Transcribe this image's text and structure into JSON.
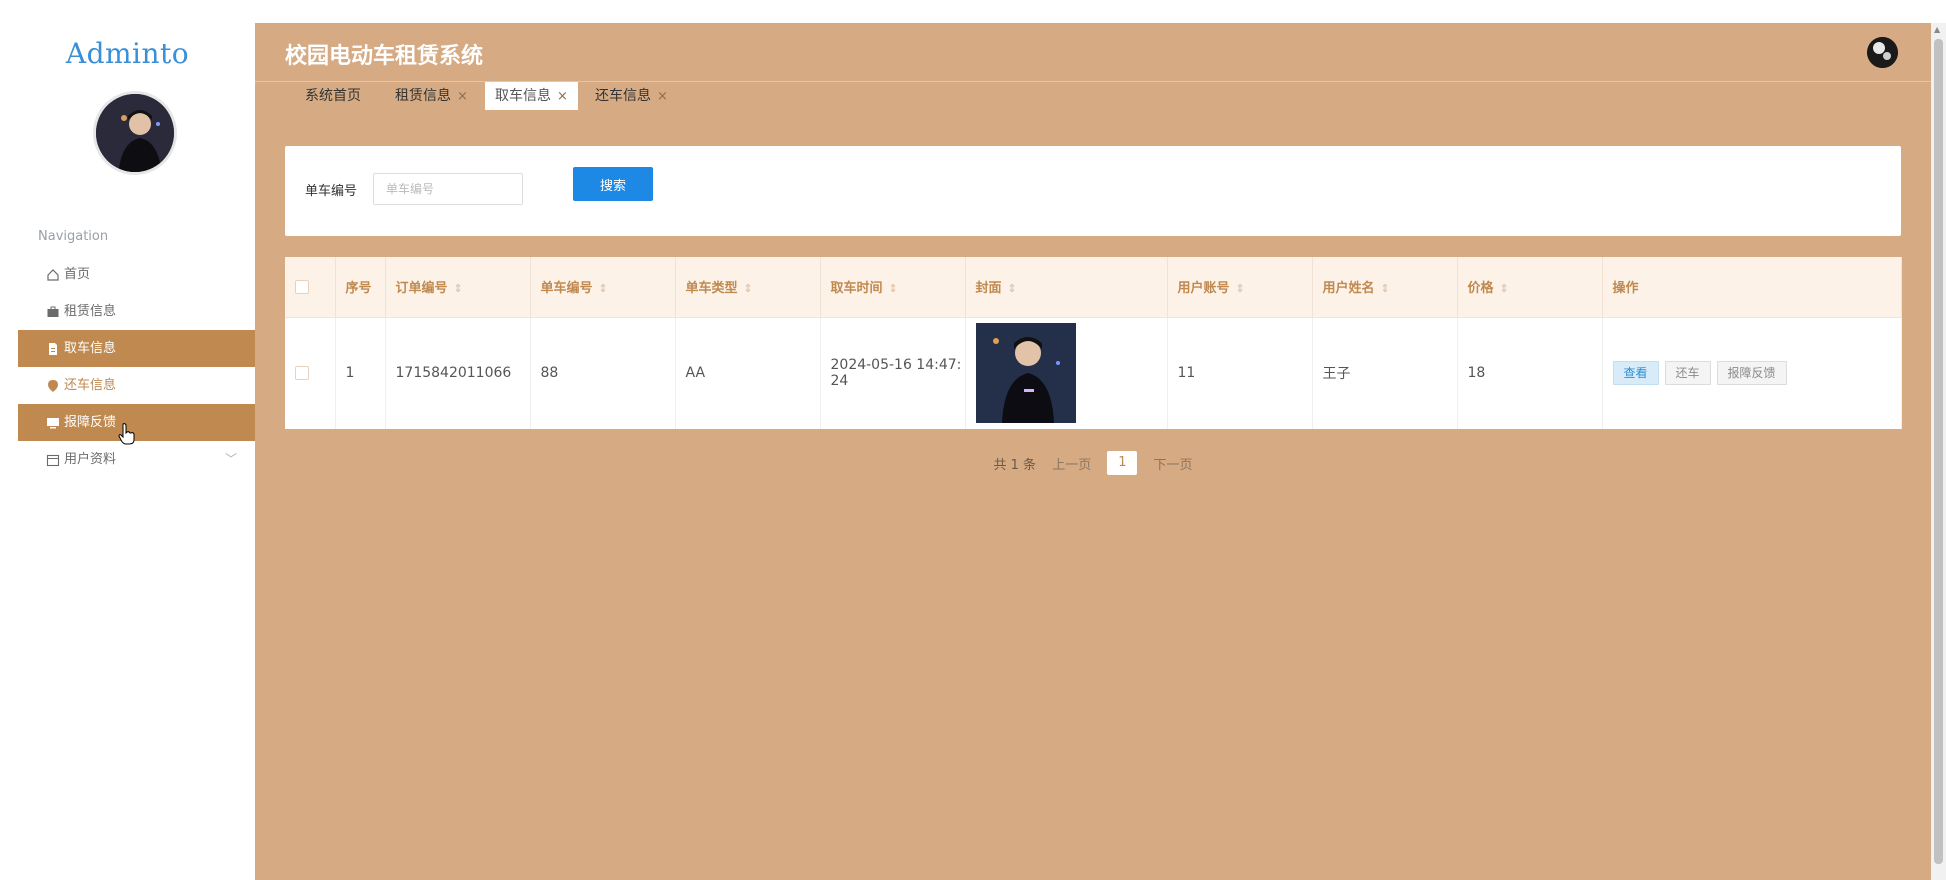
{
  "sidebar": {
    "logo": "Adminto",
    "nav_title": "Navigation",
    "items": [
      {
        "label": "首页",
        "icon": "home-icon"
      },
      {
        "label": "租赁信息",
        "icon": "briefcase-icon"
      },
      {
        "label": "取车信息",
        "icon": "document-icon"
      },
      {
        "label": "还车信息",
        "icon": "location-pin-icon"
      },
      {
        "label": "报障反馈",
        "icon": "monitor-icon"
      },
      {
        "label": "用户资料",
        "icon": "calendar-icon"
      }
    ]
  },
  "header": {
    "title": "校园电动车租赁系统"
  },
  "tabs": [
    {
      "label": "系统首页",
      "closable": false
    },
    {
      "label": "租赁信息",
      "closable": true
    },
    {
      "label": "取车信息",
      "closable": true,
      "active": true
    },
    {
      "label": "还车信息",
      "closable": true
    }
  ],
  "search": {
    "label": "单车编号",
    "placeholder": "单车编号",
    "button": "搜索"
  },
  "table": {
    "columns": [
      "序号",
      "订单编号",
      "单车编号",
      "单车类型",
      "取车时间",
      "封面",
      "用户账号",
      "用户姓名",
      "价格",
      "操作"
    ],
    "rows": [
      {
        "index": "1",
        "order_no": "1715842011066",
        "bike_no": "88",
        "bike_type": "AA",
        "pickup_time_line1": "2024-05-16 14:47:",
        "pickup_time_line2": "24",
        "user_account": "11",
        "user_name": "王子",
        "price": "18",
        "actions": [
          "查看",
          "还车",
          "报障反馈"
        ]
      }
    ]
  },
  "pagination": {
    "total": "共 1 条",
    "prev": "上一页",
    "current": "1",
    "next": "下一页"
  },
  "colors": {
    "main_bg": "#d6ab84",
    "accent": "#c0894f",
    "primary": "#1e88e5",
    "header_row": "#fdf2e8"
  }
}
